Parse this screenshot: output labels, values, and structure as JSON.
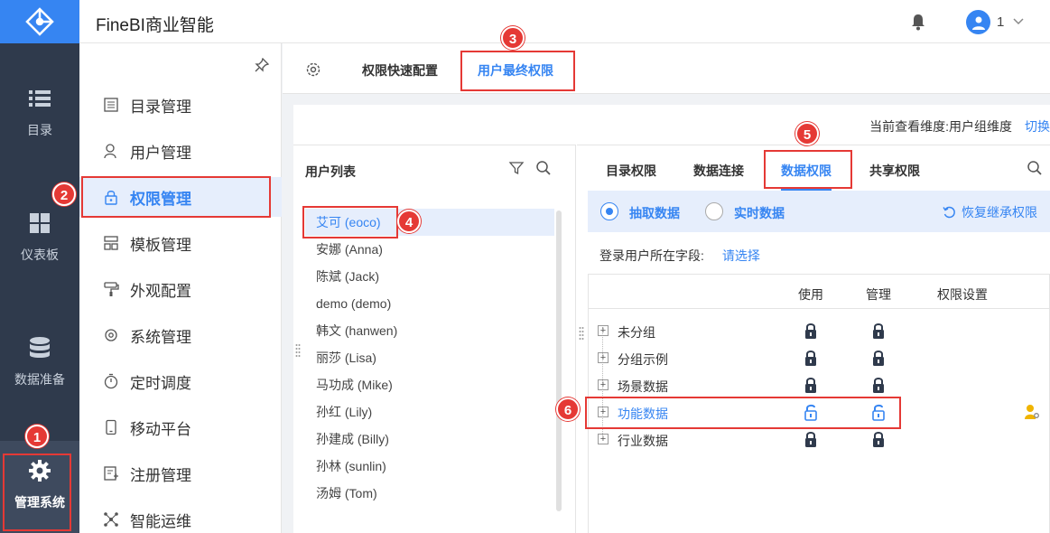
{
  "app": {
    "title": "FineBI商业智能",
    "user_name": "1"
  },
  "leftnav": [
    {
      "label": "目录",
      "icon": "list-icon"
    },
    {
      "label": "仪表板",
      "icon": "dashboard-icon"
    },
    {
      "label": "数据准备",
      "icon": "database-icon"
    },
    {
      "label": "管理系统",
      "icon": "gear-icon",
      "active": true
    }
  ],
  "sidebar": [
    {
      "label": "目录管理",
      "icon": "catalog-icon"
    },
    {
      "label": "用户管理",
      "icon": "user-icon"
    },
    {
      "label": "权限管理",
      "icon": "lock-icon",
      "active": true
    },
    {
      "label": "模板管理",
      "icon": "template-icon"
    },
    {
      "label": "外观配置",
      "icon": "paint-roller-icon"
    },
    {
      "label": "系统管理",
      "icon": "settings-icon"
    },
    {
      "label": "定时调度",
      "icon": "timer-icon"
    },
    {
      "label": "移动平台",
      "icon": "mobile-icon"
    },
    {
      "label": "注册管理",
      "icon": "register-icon"
    },
    {
      "label": "智能运维",
      "icon": "ops-icon"
    }
  ],
  "tabs": {
    "quick_config": "权限快速配置",
    "final_perm": "用户最终权限"
  },
  "dimension": {
    "text": "当前查看维度:用户组维度",
    "switch": "切换"
  },
  "users": {
    "title": "用户列表",
    "list": [
      "艾可 (eoco)",
      "安娜 (Anna)",
      "陈斌 (Jack)",
      "demo (demo)",
      "韩文 (hanwen)",
      "丽莎 (Lisa)",
      "马功成 (Mike)",
      "孙红 (Lily)",
      "孙建成 (Billy)",
      "孙林 (sunlin)",
      "汤姆 (Tom)"
    ]
  },
  "perm_tabs": {
    "catalog": "目录权限",
    "connection": "数据连接",
    "data": "数据权限",
    "share": "共享权限"
  },
  "mode": {
    "extract": "抽取数据",
    "realtime": "实时数据",
    "restore": "恢复继承权限"
  },
  "field": {
    "label": "登录用户所在字段:",
    "select": "请选择"
  },
  "table": {
    "headers": {
      "use": "使用",
      "manage": "管理",
      "setting": "权限设置"
    },
    "rows": [
      "未分组",
      "分组示例",
      "场景数据",
      "功能数据",
      "行业数据"
    ]
  },
  "badges": [
    "1",
    "2",
    "3",
    "4",
    "5",
    "6"
  ],
  "colors": {
    "accent": "#3685f2",
    "callout": "#e53935",
    "nav_bg": "#2f3a4c"
  }
}
